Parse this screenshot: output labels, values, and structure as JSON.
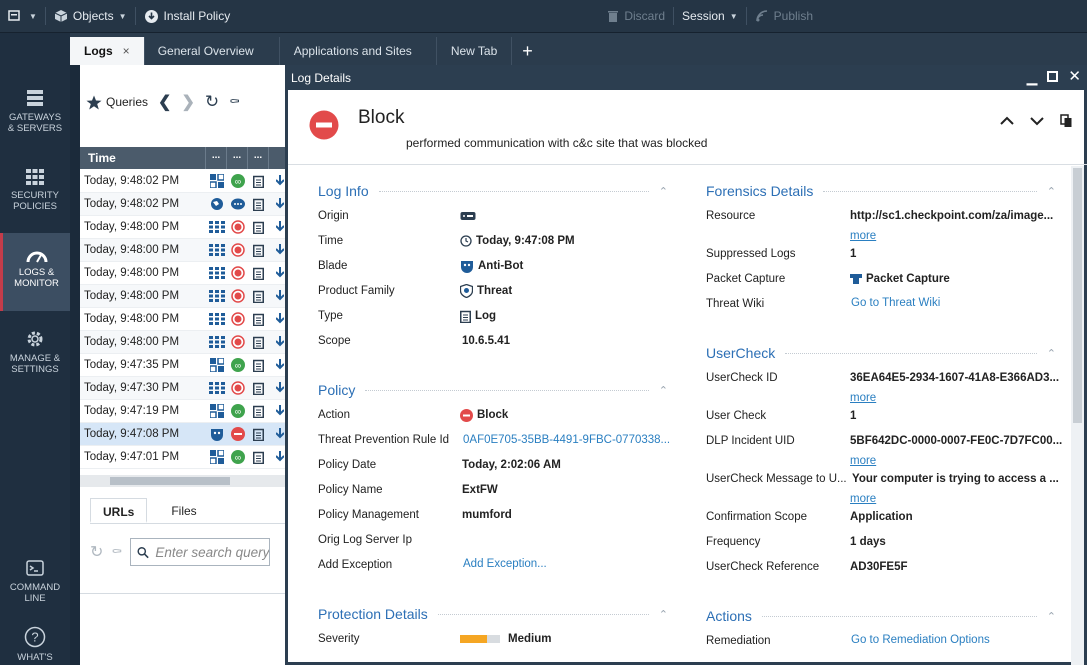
{
  "toolbar": {
    "objects_label": "Objects",
    "install_policy_label": "Install Policy",
    "discard_label": "Discard",
    "session_label": "Session",
    "publish_label": "Publish"
  },
  "sidebar": {
    "items": [
      {
        "line1": "GATEWAYS",
        "line2": "& SERVERS"
      },
      {
        "line1": "SECURITY",
        "line2": "POLICIES"
      },
      {
        "line1": "LOGS &",
        "line2": "MONITOR"
      },
      {
        "line1": "MANAGE &",
        "line2": "SETTINGS"
      },
      {
        "line1": "COMMAND",
        "line2": "LINE"
      },
      {
        "line1": "WHAT'S",
        "line2": ""
      }
    ]
  },
  "tabs": {
    "logs": "Logs",
    "close": "×",
    "general_overview": "General Overview",
    "applications_and_sites": "Applications and Sites",
    "new_tab": "New Tab",
    "add": "+"
  },
  "logs_panel": {
    "queries_label": "Queries",
    "col_time": "Time",
    "col_more": "...",
    "rows": [
      {
        "time": "Today, 9:48:02 PM"
      },
      {
        "time": "Today, 9:48:02 PM"
      },
      {
        "time": "Today, 9:48:00 PM"
      },
      {
        "time": "Today, 9:48:00 PM"
      },
      {
        "time": "Today, 9:48:00 PM"
      },
      {
        "time": "Today, 9:48:00 PM"
      },
      {
        "time": "Today, 9:48:00 PM"
      },
      {
        "time": "Today, 9:48:00 PM"
      },
      {
        "time": "Today, 9:47:35 PM"
      },
      {
        "time": "Today, 9:47:30 PM"
      },
      {
        "time": "Today, 9:47:19 PM"
      },
      {
        "time": "Today, 9:47:08 PM"
      },
      {
        "time": "Today, 9:47:01 PM"
      }
    ],
    "subtab_urls": "URLs",
    "subtab_files": "Files",
    "search_placeholder": "Enter search query"
  },
  "dialog": {
    "title": "Log Details",
    "action_title": "Block",
    "description": "performed communication with c&c site that was blocked",
    "log_info": {
      "heading": "Log Info",
      "origin_label": "Origin",
      "time_label": "Time",
      "time_value": "Today, 9:47:08 PM",
      "blade_label": "Blade",
      "blade_value": "Anti-Bot",
      "product_family_label": "Product Family",
      "product_family_value": "Threat",
      "type_label": "Type",
      "type_value": "Log",
      "scope_label": "Scope",
      "scope_value": "10.6.5.41"
    },
    "policy": {
      "heading": "Policy",
      "action_label": "Action",
      "action_value": "Block",
      "rule_id_label": "Threat Prevention Rule Id",
      "rule_id_value": "0AF0E705-35BB-4491-9FBC-0770338...",
      "policy_date_label": "Policy Date",
      "policy_date_value": "Today, 2:02:06 AM",
      "policy_name_label": "Policy Name",
      "policy_name_value": "ExtFW",
      "policy_mgmt_label": "Policy Management",
      "policy_mgmt_value": "mumford",
      "orig_log_label": "Orig Log Server Ip",
      "add_exception_label": "Add Exception",
      "add_exception_value": "Add Exception..."
    },
    "protection": {
      "heading": "Protection Details",
      "severity_label": "Severity",
      "severity_value": "Medium"
    },
    "forensics": {
      "heading": "Forensics Details",
      "resource_label": "Resource",
      "resource_value": "http://sc1.checkpoint.com/za/image...",
      "more": "more",
      "suppressed_label": "Suppressed Logs",
      "suppressed_value": "1",
      "packet_label": "Packet Capture",
      "packet_value": "Packet Capture",
      "wiki_label": "Threat Wiki",
      "wiki_value": "Go to Threat Wiki"
    },
    "usercheck": {
      "heading": "UserCheck",
      "id_label": "UserCheck ID",
      "id_value": "36EA64E5-2934-1607-41A8-E366AD3...",
      "more": "more",
      "user_check_label": "User Check",
      "user_check_value": "1",
      "dlp_label": "DLP Incident UID",
      "dlp_value": "5BF642DC-0000-0007-FE0C-7D7FC00...",
      "message_label": "UserCheck Message to U...",
      "message_value": "Your computer is trying to access a ...",
      "scope_label": "Confirmation Scope",
      "scope_value": "Application",
      "frequency_label": "Frequency",
      "frequency_value": "1 days",
      "reference_label": "UserCheck Reference",
      "reference_value": "AD30FE5F"
    },
    "actions": {
      "heading": "Actions",
      "remediation_label": "Remediation",
      "remediation_value": "Go to Remediation Options"
    }
  },
  "colors": {
    "block_red": "#e24a4a",
    "link_blue": "#2a7fc1",
    "section_blue": "#2c6fb5",
    "window_frame": "#2c3e50"
  }
}
